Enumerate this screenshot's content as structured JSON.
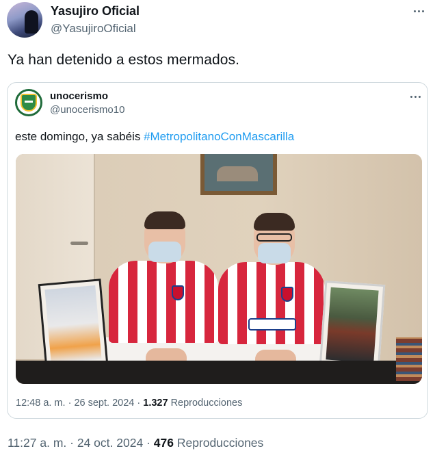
{
  "tweet": {
    "display_name": "Yasujiro Oficial",
    "handle": "@YasujiroOficial",
    "text": "Ya han detenido a estos mermados.",
    "time": "11:27 a. m.",
    "separator": "·",
    "date": "24 oct. 2024",
    "views_count": "476",
    "views_label": "Reproducciones",
    "more_icon": "more-horizontal-icon"
  },
  "quote": {
    "display_name": "unocerismo",
    "handle": "@unocerismo10",
    "text_prefix": "este domingo, ya sabéis ",
    "hashtag": "#MetropolitanoConMascarilla",
    "time": "12:48 a. m.",
    "separator": "·",
    "date": "26 sept. 2024",
    "views_count": "1.327",
    "views_label": "Reproducciones",
    "more_icon": "more-horizontal-icon"
  },
  "colors": {
    "text_primary": "#0f1419",
    "text_secondary": "#536471",
    "link": "#1d9bf0",
    "border": "#cfd9de"
  }
}
